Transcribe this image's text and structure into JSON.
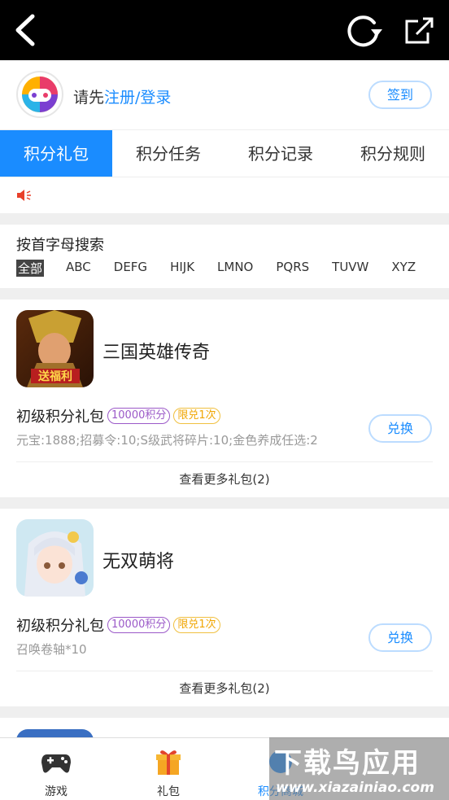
{
  "user": {
    "prompt": "请先",
    "login_link": "注册/登录",
    "checkin_label": "签到"
  },
  "tabs": [
    {
      "label": "积分礼包",
      "active": true
    },
    {
      "label": "积分任务",
      "active": false
    },
    {
      "label": "积分记录",
      "active": false
    },
    {
      "label": "积分规则",
      "active": false
    }
  ],
  "search": {
    "title": "按首字母搜索",
    "letters": [
      "全部",
      "ABC",
      "DEFG",
      "HIJK",
      "LMNO",
      "PQRS",
      "TUVW",
      "XYZ"
    ]
  },
  "games": [
    {
      "name": "三国英雄传奇",
      "icon_banner": "送福利",
      "gift_title": "初级积分礼包",
      "points_tag": "10000积分",
      "limit_tag": "限兑1次",
      "desc": "元宝:1888;招募令:10;S级武将碎片:10;金色养成任选:2",
      "exchange_label": "兑换",
      "more_label": "查看更多礼包(2)"
    },
    {
      "name": "无双萌将",
      "gift_title": "初级积分礼包",
      "points_tag": "10000积分",
      "limit_tag": "限兑1次",
      "desc": "召唤卷轴*10",
      "exchange_label": "兑换",
      "more_label": "查看更多礼包(2)"
    }
  ],
  "bottom_nav": [
    {
      "label": "游戏",
      "icon": "gamepad-icon"
    },
    {
      "label": "礼包",
      "icon": "gift-icon"
    },
    {
      "label": "积分商城",
      "icon": "points-icon"
    }
  ],
  "watermark": {
    "title": "下载鸟应用",
    "url": "www.xiazainiao.com"
  },
  "colors": {
    "accent": "#1a8cff",
    "topbar": "#000000",
    "points_tag": "#9b59c8",
    "limit_tag": "#f0a500"
  }
}
